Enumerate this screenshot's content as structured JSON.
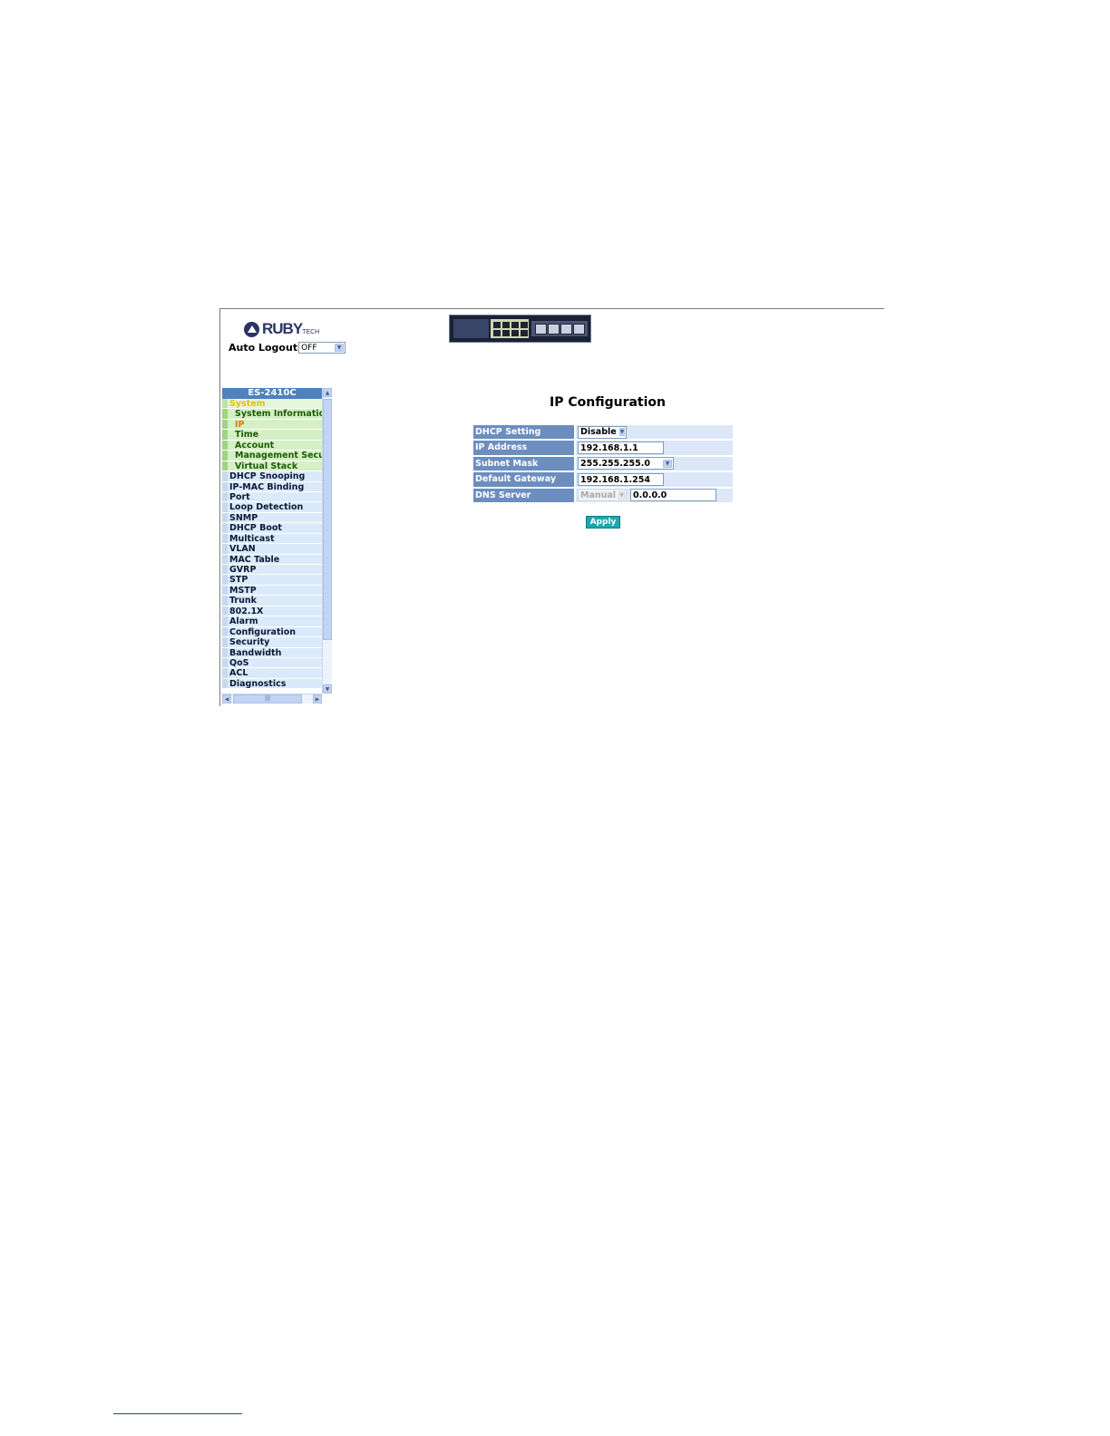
{
  "header": {
    "brand_main": "RUBY",
    "brand_suffix": "TECH",
    "auto_logout_label": "Auto Logout",
    "auto_logout_value": "OFF"
  },
  "sidebar": {
    "title": "ES-2410C",
    "items": [
      {
        "label": "System",
        "kind": "open"
      },
      {
        "label": "System Information",
        "kind": "sub"
      },
      {
        "label": "IP",
        "kind": "sub-active"
      },
      {
        "label": "Time",
        "kind": "sub"
      },
      {
        "label": "Account",
        "kind": "sub"
      },
      {
        "label": "Management Securit",
        "kind": "sub"
      },
      {
        "label": "Virtual Stack",
        "kind": "sub"
      },
      {
        "label": "DHCP Snooping",
        "kind": "top"
      },
      {
        "label": "IP-MAC Binding",
        "kind": "top"
      },
      {
        "label": "Port",
        "kind": "top"
      },
      {
        "label": "Loop Detection",
        "kind": "top"
      },
      {
        "label": "SNMP",
        "kind": "top"
      },
      {
        "label": "DHCP Boot",
        "kind": "top"
      },
      {
        "label": "Multicast",
        "kind": "top"
      },
      {
        "label": "VLAN",
        "kind": "top"
      },
      {
        "label": "MAC Table",
        "kind": "top"
      },
      {
        "label": "GVRP",
        "kind": "top"
      },
      {
        "label": "STP",
        "kind": "top"
      },
      {
        "label": "MSTP",
        "kind": "top"
      },
      {
        "label": "Trunk",
        "kind": "top"
      },
      {
        "label": "802.1X",
        "kind": "top"
      },
      {
        "label": "Alarm",
        "kind": "top"
      },
      {
        "label": "Configuration",
        "kind": "top"
      },
      {
        "label": "Security",
        "kind": "top"
      },
      {
        "label": "Bandwidth",
        "kind": "top"
      },
      {
        "label": "QoS",
        "kind": "top"
      },
      {
        "label": "ACL",
        "kind": "top"
      },
      {
        "label": "Diagnostics",
        "kind": "top"
      }
    ]
  },
  "main": {
    "title": "IP Configuration",
    "dhcp_setting": {
      "label": "DHCP Setting",
      "value": "Disable"
    },
    "ip_address": {
      "label": "IP Address",
      "value": "192.168.1.1"
    },
    "subnet_mask": {
      "label": "Subnet Mask",
      "value": "255.255.255.0"
    },
    "default_gateway": {
      "label": "Default Gateway",
      "value": "192.168.1.254"
    },
    "dns_server": {
      "label": "DNS Server",
      "mode": "Manual",
      "value": "0.0.0.0"
    },
    "apply_label": "Apply"
  },
  "icons": {
    "dropdown": "chevron-down-icon",
    "scroll_up": "arrow-up-icon",
    "scroll_down": "arrow-down-icon",
    "scroll_left": "arrow-left-icon",
    "scroll_right": "arrow-right-icon"
  }
}
